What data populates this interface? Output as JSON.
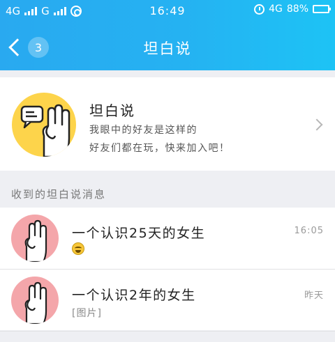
{
  "status_bar": {
    "network1": "4G",
    "network2": "G",
    "time": "16:49",
    "network_right": "4G",
    "battery": "88%"
  },
  "header": {
    "back_count": "3",
    "title": "坦白说"
  },
  "intro": {
    "title": "坦白说",
    "desc_line1": "我眼中的好友是这样的",
    "desc_line2": "好友们都在玩，快来加入吧！"
  },
  "section": {
    "label": "收到的坦白说消息"
  },
  "messages": [
    {
      "title": "一个认识25天的女生",
      "subtitle": "",
      "time": "16:05",
      "has_emoji": true
    },
    {
      "title": "一个认识2年的女生",
      "subtitle": "[图片]",
      "time": "昨天",
      "has_emoji": false
    }
  ],
  "colors": {
    "header_gradient_start": "#29a9f0",
    "header_gradient_end": "#1dc3f5",
    "intro_avatar": "#fdd44b",
    "message_avatar": "#f4a6aa"
  },
  "icons": {
    "back": "chevron-left-icon",
    "intro_avatar": "hand-with-speech-bubble-icon",
    "message_avatar": "hand-icon",
    "arrow": "chevron-right-icon"
  }
}
